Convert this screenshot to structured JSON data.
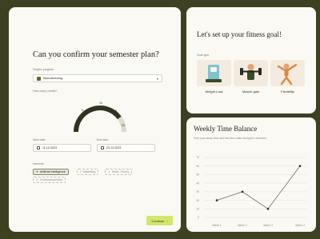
{
  "semester": {
    "title": "Can you confirm your semester plan?",
    "degree_label": "Degree program",
    "degree_value": "Manufacturing",
    "credits_label": "How many credits?",
    "gauge": {
      "min": "0",
      "t1": "5",
      "t2": "10",
      "t3": "15",
      "max": "20",
      "value_fraction": 0.8
    },
    "start_label": "Start date",
    "start_value": "11-12-2023",
    "end_label": "End date",
    "end_value": "23-12-2023",
    "interests_label": "Interests",
    "interests": [
      "Artificial Intelligence",
      "Marketing",
      "Music Theory",
      "Entrepreneurship"
    ],
    "continue_label": "Continue"
  },
  "fitness": {
    "title": "Let's set up your fitness goal!",
    "goal_type_label": "Goal type",
    "goals": [
      "Weight Loss",
      "Muscle gain",
      "Flexibility"
    ]
  },
  "chart_data": {
    "type": "line",
    "title": "Weekly Time Balance",
    "subtitle": "Here your study time and free time stats during the semester",
    "categories": [
      "Week 1",
      "Week 2",
      "Week 3",
      "Week 4"
    ],
    "series": [
      {
        "values": [
          20,
          30,
          10,
          60
        ]
      }
    ],
    "ylim": [
      0,
      70
    ],
    "yticks": [
      "0",
      "10",
      "20",
      "30",
      "40",
      "50",
      "60",
      "70"
    ],
    "grid": true,
    "colors": {
      "line": "#6f6f6f",
      "point": "#2b2b2b",
      "grid": "#e4e1d6"
    }
  }
}
